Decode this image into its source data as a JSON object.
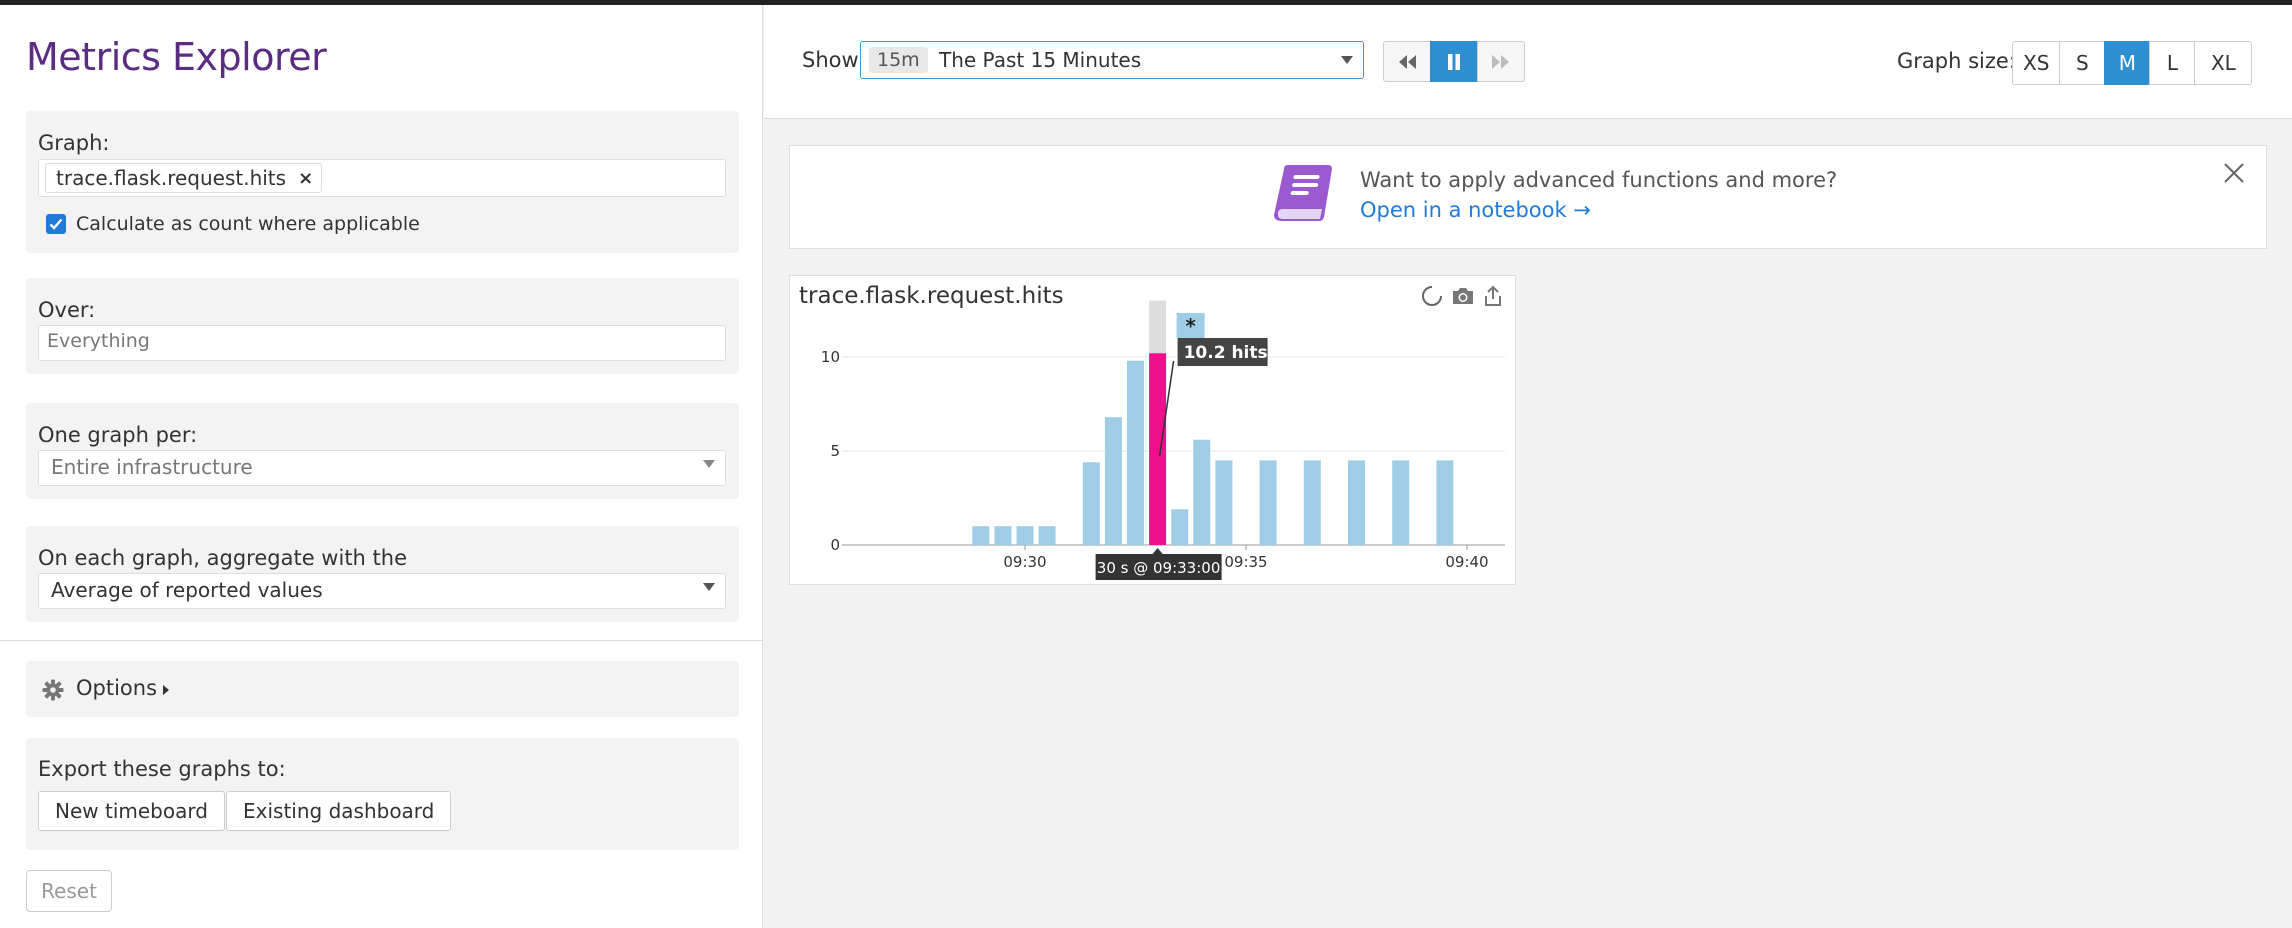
{
  "left_panel": {
    "title": "Metrics Explorer",
    "graph": {
      "label": "Graph:",
      "metric_tag": "trace.flask.request.hits",
      "remove_symbol": "×",
      "checkbox_label": "Calculate as count where applicable",
      "checked": true
    },
    "over": {
      "label": "Over:",
      "placeholder": "Everything"
    },
    "one_graph_per": {
      "label": "One graph per:",
      "value": "Entire infrastructure"
    },
    "aggregate": {
      "label": "On each graph, aggregate with the",
      "value": "Average of reported values"
    },
    "options_label": "Options",
    "export": {
      "label": "Export these graphs to:",
      "new_timeboard": "New timeboard",
      "existing_dashboard": "Existing dashboard"
    },
    "reset_label": "Reset"
  },
  "toolbar": {
    "show_label": "Show",
    "time_badge": "15m",
    "time_value": "The Past 15 Minutes",
    "graph_size_label": "Graph size:",
    "sizes": [
      "XS",
      "S",
      "M",
      "L",
      "XL"
    ],
    "active_size": "M"
  },
  "banner": {
    "text": "Want to apply advanced functions and more?",
    "link": "Open in a notebook →"
  },
  "chart_data": {
    "type": "bar",
    "title": "trace.flask.request.hits",
    "ylim": [
      0,
      13
    ],
    "yticks": [
      "0",
      "5",
      "10"
    ],
    "ytick_values": [
      0,
      5,
      10
    ],
    "x_ticks": [
      {
        "label": "09:30",
        "minute": 30
      },
      {
        "label": "09:35",
        "minute": 35
      },
      {
        "label": "09:40",
        "minute": 40
      }
    ],
    "bar_minutes": [
      29.0,
      29.5,
      30.0,
      30.5,
      31.5,
      32.0,
      32.5,
      33.0,
      33.5,
      34.0,
      34.5,
      35.5,
      36.5,
      37.5,
      38.5,
      39.5
    ],
    "values": [
      1,
      1,
      1,
      1,
      4.4,
      6.8,
      9.8,
      10.2,
      1.9,
      5.6,
      4.5,
      4.5,
      4.5,
      4.5,
      4.5,
      4.5
    ],
    "highlight_index": 7,
    "highlight_total": 13,
    "tooltip_value": "10.2 hits",
    "tooltip_time": "30 s @ 09:33:00",
    "marker_symbol": "*",
    "colors": {
      "bar": "#9fcde6",
      "highlight": "#ef0e8c",
      "highlight_rest": "#dddddd"
    }
  },
  "colors": {
    "accent": "#2d8fd0",
    "title": "#5a2d82",
    "link": "#1f7bd8"
  }
}
